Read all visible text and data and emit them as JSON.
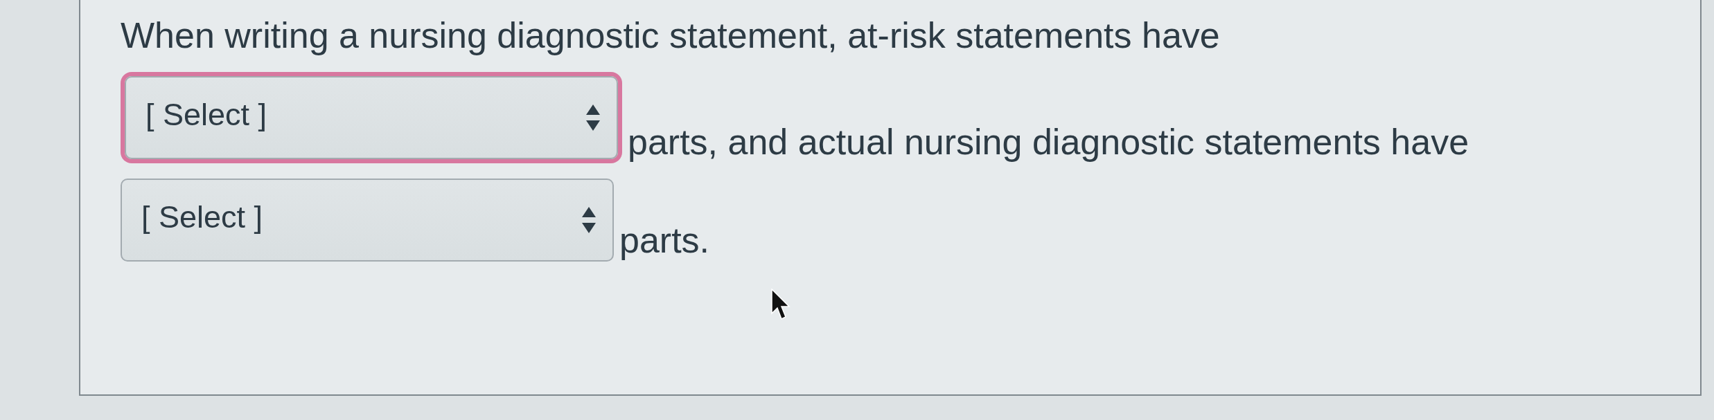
{
  "question": {
    "parts": [
      {
        "kind": "text",
        "text": "When writing a nursing diagnostic statement, at-risk statements have"
      },
      {
        "kind": "select",
        "placeholder": "[ Select ]",
        "focused": true
      },
      {
        "kind": "text",
        "text": "parts, and actual nursing diagnostic statements have"
      },
      {
        "kind": "select",
        "placeholder": "[ Select ]",
        "focused": false
      },
      {
        "kind": "text",
        "text": "parts."
      }
    ]
  }
}
